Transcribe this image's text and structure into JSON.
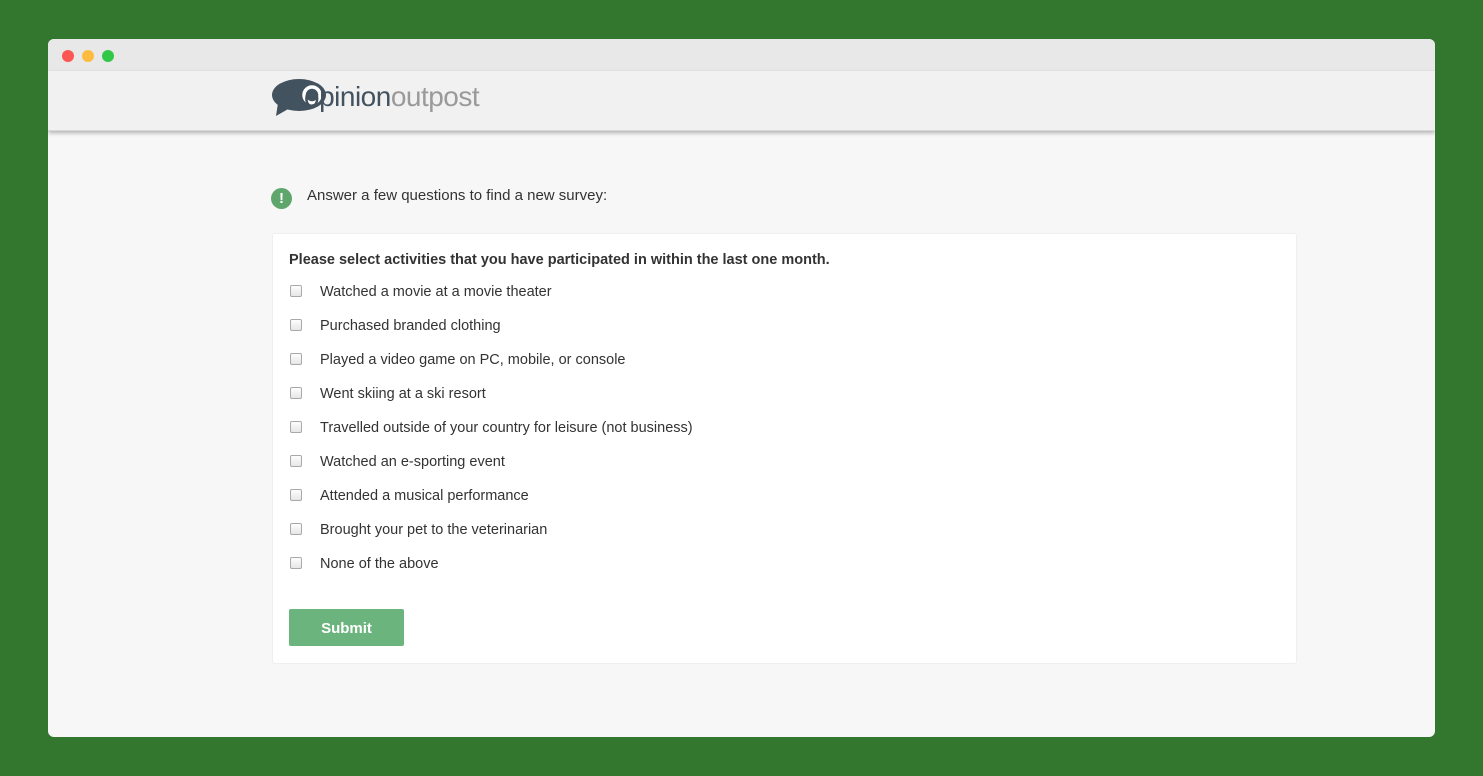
{
  "window": {
    "controls": [
      "close",
      "minimize",
      "maximize"
    ]
  },
  "header": {
    "logo": {
      "part1": "opinion",
      "part2": "outpost",
      "icon": "speech-bubble-icon"
    }
  },
  "notice": {
    "icon": "exclamation-icon",
    "text": "Answer a few questions to find a new survey:"
  },
  "form": {
    "question": "Please select activities that you have participated in within the last one month.",
    "options": [
      {
        "label": "Watched a movie at a movie theater",
        "checked": false
      },
      {
        "label": "Purchased branded clothing",
        "checked": false
      },
      {
        "label": "Played a video game on PC, mobile, or console",
        "checked": false
      },
      {
        "label": "Went skiing at a ski resort",
        "checked": false
      },
      {
        "label": "Travelled outside of your country for leisure (not business)",
        "checked": false
      },
      {
        "label": "Watched an e-sporting event",
        "checked": false
      },
      {
        "label": "Attended a musical performance",
        "checked": false
      },
      {
        "label": "Brought your pet to the veterinarian",
        "checked": false
      },
      {
        "label": "None of the above",
        "checked": false
      }
    ],
    "submit_label": "Submit"
  },
  "colors": {
    "background": "#33772f",
    "accent": "#6cb47d",
    "logo_dark": "#43525f",
    "logo_light": "#9a9a9a"
  }
}
